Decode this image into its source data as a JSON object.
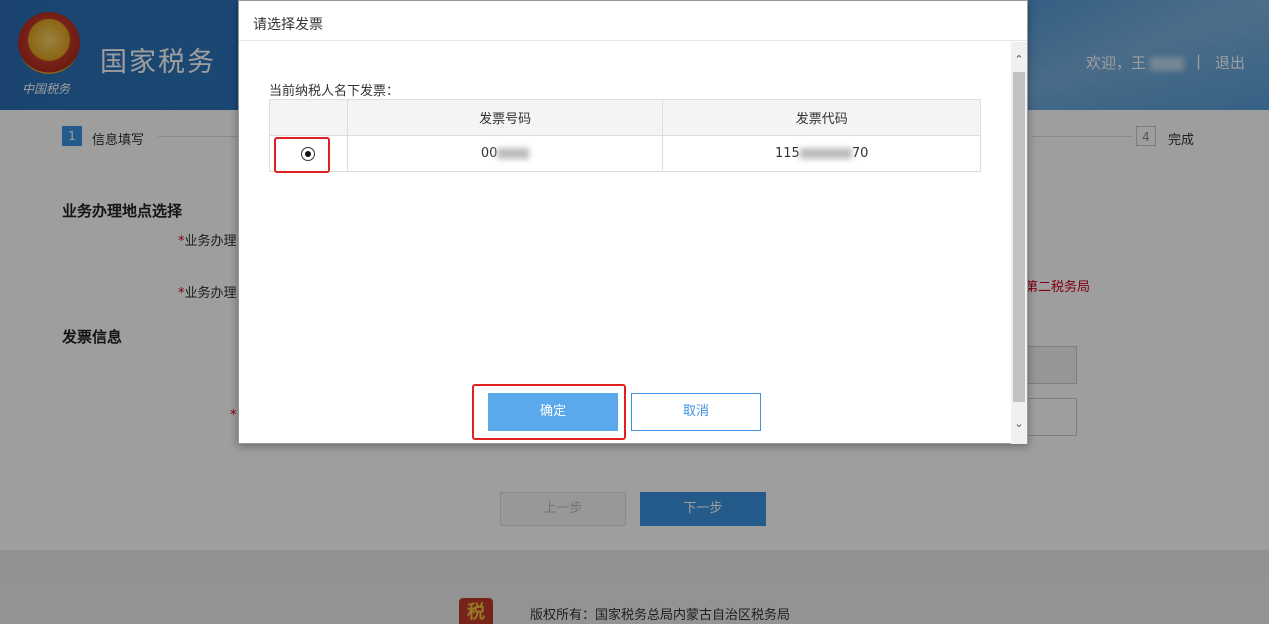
{
  "header": {
    "site_title": "国家税务",
    "emblem_text": "中国税务",
    "welcome": "欢迎，王",
    "separator": "|",
    "logout": "退出"
  },
  "steps": [
    {
      "num": "1",
      "label": "信息填写"
    },
    {
      "num": "4",
      "label": "完成"
    }
  ],
  "form": {
    "section_location": "业务办理地点选择",
    "label_location_1": "业务办理",
    "label_location_2": "业务办理",
    "location_value": "第二税务局",
    "section_invoice": "发票信息",
    "required_mark": "*"
  },
  "nav": {
    "prev": "上一步",
    "next": "下一步"
  },
  "footer": {
    "copyright": "版权所有：国家税务总局内蒙古自治区税务局",
    "logo_glyph": "税"
  },
  "modal": {
    "title": "请选择发票",
    "subtitle": "当前纳税人名下发票：",
    "columns": [
      "发票号码",
      "发票代码"
    ],
    "rows": [
      {
        "number_prefix": "00",
        "code_prefix": "115",
        "code_suffix": "70"
      }
    ],
    "confirm": "确定",
    "cancel": "取消"
  },
  "colors": {
    "accent": "#3d93e1",
    "highlight": "#e02020",
    "required": "#d0021b"
  }
}
